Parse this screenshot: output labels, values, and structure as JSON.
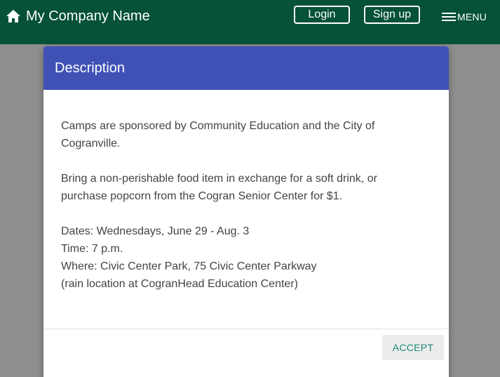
{
  "header": {
    "brand_icon": "home-icon",
    "brand_name": "My Company Name",
    "login_label": "Login",
    "signup_label": "Sign up",
    "menu_icon": "hamburger-icon",
    "menu_label": "MENU",
    "colors": {
      "header_bg": "#05513a",
      "text": "#ffffff"
    }
  },
  "modal": {
    "title": "Description",
    "header_color": "#3f51b5",
    "paragraphs": [
      {
        "lines": [
          "Camps are sponsored by Community Education and the City of",
          "Cogranville."
        ]
      },
      {
        "lines": [
          "Bring a non-perishable food item in exchange for a soft drink, or",
          "purchase popcorn from the Cogran Senior Center for $1."
        ]
      },
      {
        "lines": [
          "Dates: Wednesdays, June 29 - Aug. 3",
          "Time: 7 p.m.",
          "Where: Civic Center Park, 75 Civic Center Parkway",
          "(rain location at CogranHead Education Center)"
        ]
      }
    ],
    "accept_label": "ACCEPT",
    "accept_color": "#1c8c78"
  }
}
